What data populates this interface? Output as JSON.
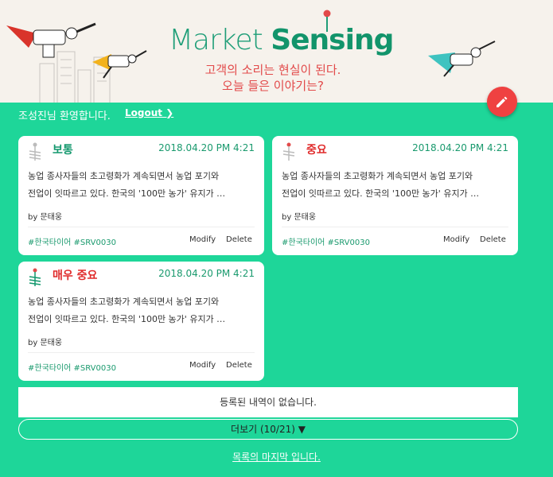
{
  "header": {
    "logo_light": "Market ",
    "logo_bold": "Sensing",
    "tagline_line1": "고객의 소리는 현실이 된다.",
    "tagline_line2": "오늘 들은 이야기는?"
  },
  "welcome": {
    "text": "조성진님 환영합니다.",
    "logout_label": "Logout ❯"
  },
  "colors": {
    "accent": "#1ed699",
    "green_text": "#1a9a6e",
    "red": "#e02b2b",
    "fab": "#ef4141"
  },
  "cards": [
    {
      "level": "보통",
      "date": "2018.04.20 PM 4:21",
      "body_line1": "농업 종사자들의 초고령화가 계속되면서 농업 포기와",
      "body_line2": "전업이 잇따르고 있다. 한국의 '100만 농가' 유지가 …",
      "author": "by 문태웅",
      "tags": "#한국타이어 #SRV0030",
      "modify": "Modify",
      "delete": "Delete"
    },
    {
      "level": "중요",
      "date": "2018.04.20 PM 4:21",
      "body_line1": "농업 종사자들의 초고령화가 계속되면서 농업 포기와",
      "body_line2": "전업이 잇따르고 있다. 한국의 '100만 농가' 유지가 …",
      "author": "by 문태웅",
      "tags": "#한국타이어 #SRV0030",
      "modify": "Modify",
      "delete": "Delete"
    },
    {
      "level": "매우 중요",
      "date": "2018.04.20 PM 4:21",
      "body_line1": "농업 종사자들의 초고령화가 계속되면서 농업 포기와",
      "body_line2": "전업이 잇따르고 있다. 한국의 '100만 농가' 유지가 …",
      "author": "by 문태웅",
      "tags": "#한국타이어 #SRV0030",
      "modify": "Modify",
      "delete": "Delete"
    }
  ],
  "empty_message": "등록된 내역이 없습니다.",
  "more_label": "더보기 (10/21) ▼",
  "end_message": "목록의 마지막 입니다."
}
